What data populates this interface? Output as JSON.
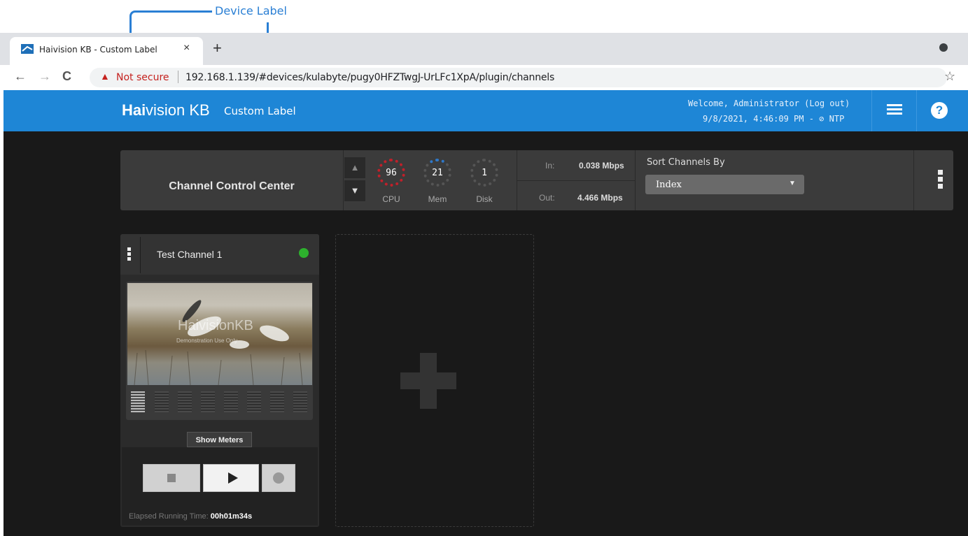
{
  "callout": {
    "label": "Device Label"
  },
  "browser": {
    "tab_title": "Haivision KB - Custom Label",
    "tab_close": "×",
    "new_tab": "+",
    "nav_back": "←",
    "nav_forward": "→",
    "reload": "C",
    "warning_icon": "▲",
    "not_secure": "Not secure",
    "url": "192.168.1.139/#devices/kulabyte/pugy0HFZTwgJ-UrLFc1XpA/plugin/channels",
    "star": "☆"
  },
  "header": {
    "logo_bold": "Hai",
    "logo_rest": "vision KB",
    "device_label": "Custom Label",
    "welcome": "Welcome, Administrator  (Log out)",
    "datetime": "9/8/2021, 4:46:09 PM - ⊘ NTP",
    "help": "?"
  },
  "control_center": {
    "title": "Channel Control Center",
    "arrow_up": "▲",
    "arrow_down": "▼",
    "gauges": [
      {
        "value": "96",
        "label": "CPU"
      },
      {
        "value": "21",
        "label": "Mem"
      },
      {
        "value": "1",
        "label": "Disk"
      }
    ],
    "in_label": "In:",
    "in_value": "0.038 Mbps",
    "out_label": "Out:",
    "out_value": "4.466 Mbps",
    "sort_label": "Sort Channels By",
    "sort_value": "Index",
    "sort_caret": "▼"
  },
  "channel": {
    "name": "Test Channel 1",
    "status": "running",
    "watermark_title": "HaivisionKB",
    "watermark_sub": "Demonstration Use Only",
    "show_meters": "Show Meters",
    "elapsed_label": "Elapsed Running Time:",
    "elapsed_value": "00h01m34s"
  },
  "colors": {
    "header_blue": "#1e86d6",
    "status_green": "#2db12d",
    "cpu_ring": "#c0202a",
    "mem_ring": "#2f78c8"
  }
}
